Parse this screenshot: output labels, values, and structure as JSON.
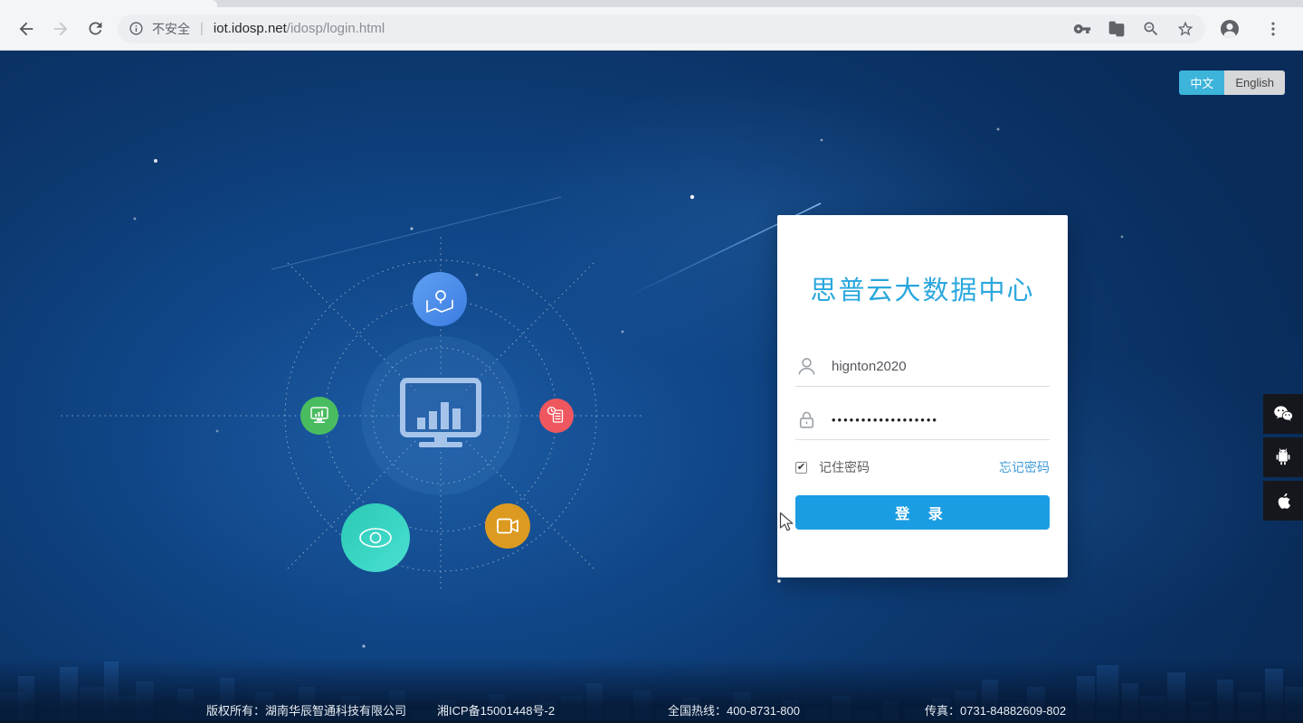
{
  "browser": {
    "security_label": "不安全",
    "separator": "|",
    "url_host": "iot.idosp.net",
    "url_path": "/idosp/login.html"
  },
  "language": {
    "zh": "中文",
    "en": "English"
  },
  "login": {
    "title": "思普云大数据中心",
    "username": "hignton2020",
    "password_mask": "••••••••••••••••••",
    "remember_label": "记住密码",
    "remember_checked": "checked",
    "check_glyph": "✔",
    "forgot_label": "忘记密码",
    "submit_label": "登 录"
  },
  "footer": {
    "copyright": "版权所有：湖南华辰智通科技有限公司",
    "icp": "湘ICP备15001448号-2",
    "hotline": "全国热线：400-8731-800",
    "fax": "传真：0731-84882609-802"
  },
  "colors": {
    "accent_button": "#1b9de3",
    "title_blue": "#2aa7dd",
    "link_blue": "#3f9cd8",
    "lang_active_cyan": "#3db4d9",
    "page_navy": "#0c386f",
    "pin_circle": "#4a8fe8",
    "green_circle": "#4abc60",
    "red_circle": "#ef575f",
    "teal_circle": "#35d2c0",
    "orange_circle": "#dc9a20"
  }
}
